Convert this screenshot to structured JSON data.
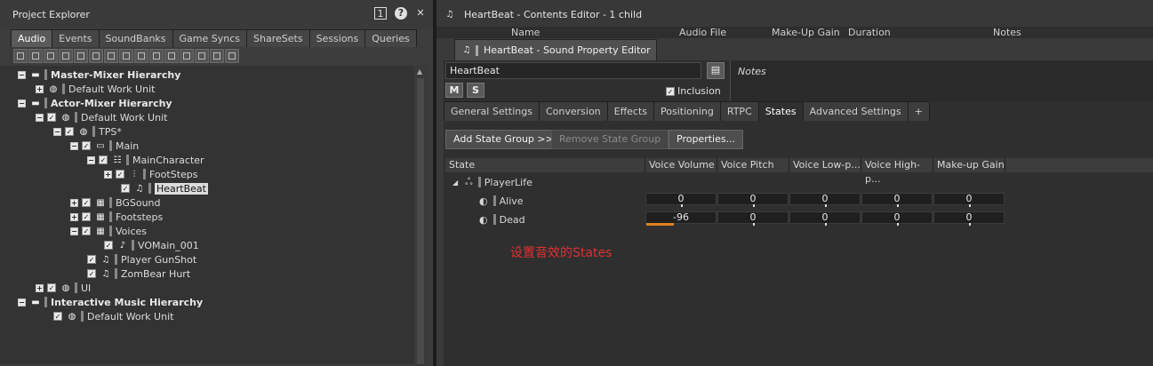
{
  "left": {
    "title": "Project Explorer",
    "title_buttons": [
      "1",
      "?",
      "✕"
    ],
    "tabs": [
      "Audio",
      "Events",
      "SoundBanks",
      "Game Syncs",
      "ShareSets",
      "Sessions",
      "Queries"
    ],
    "tree": [
      {
        "label": "Master-Mixer Hierarchy",
        "bold": true
      },
      {
        "label": "Default Work Unit"
      },
      {
        "label": "Actor-Mixer Hierarchy",
        "bold": true
      },
      {
        "label": "Default Work Unit"
      },
      {
        "label": "TPS*"
      },
      {
        "label": "Main"
      },
      {
        "label": "MainCharacter"
      },
      {
        "label": "FootSteps"
      },
      {
        "label": "HeartBeat"
      },
      {
        "label": "BGSound"
      },
      {
        "label": "Footsteps"
      },
      {
        "label": "Voices"
      },
      {
        "label": "VOMain_001"
      },
      {
        "label": "Player GunShot"
      },
      {
        "label": "ZomBear Hurt"
      },
      {
        "label": "UI"
      },
      {
        "label": "Interactive Music Hierarchy",
        "bold": true
      },
      {
        "label": "Default Work Unit"
      }
    ]
  },
  "right": {
    "title": "HeartBeat - Contents Editor - 1 child",
    "columns": [
      "Name",
      "Audio File",
      "Make-Up Gain",
      "Duration",
      "Notes"
    ],
    "prop_tab_title": "HeartBeat - Sound Property Editor",
    "object_name": "HeartBeat",
    "m_label": "M",
    "s_label": "S",
    "notes_placeholder": "Notes",
    "inclusion_label": "Inclusion",
    "tabs": [
      "General Settings",
      "Conversion",
      "Effects",
      "Positioning",
      "RTPC",
      "States",
      "Advanced Settings",
      "+"
    ],
    "active_tab": "States",
    "add_state_group": "Add State Group >>",
    "remove_state_group": "Remove State Group",
    "properties_btn": "Properties...",
    "grid_headers": [
      "State",
      "Voice Volume",
      "Voice Pitch",
      "Voice Low-p...",
      "Voice High-p...",
      "Make-up Gain"
    ],
    "state_group": "PlayerLife",
    "states": [
      {
        "name": "Alive",
        "values": [
          "0",
          "0",
          "0",
          "0",
          "0"
        ]
      },
      {
        "name": "Dead",
        "values": [
          "-96",
          "0",
          "0",
          "0",
          "0"
        ],
        "volume_fraction": 0.4
      }
    ],
    "annotation": "设置音效的States",
    "accent_color": "#e08020",
    "annotation_color": "#e03030"
  }
}
